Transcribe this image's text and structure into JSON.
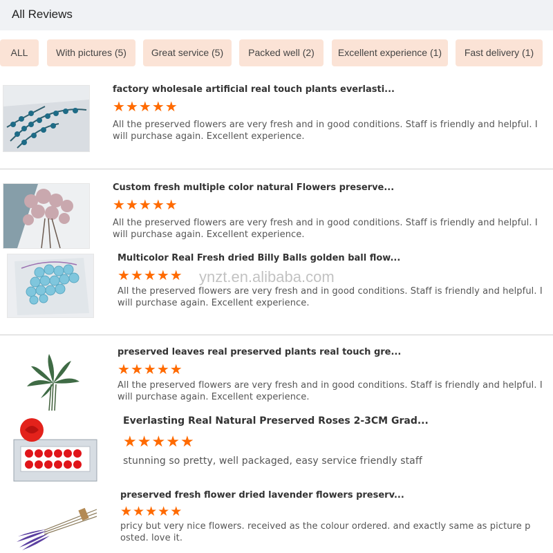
{
  "header": {
    "title": "All Reviews"
  },
  "filters": [
    {
      "label": "ALL"
    },
    {
      "label": "With pictures (5)"
    },
    {
      "label": "Great service (5)"
    },
    {
      "label": "Packed well (2)"
    },
    {
      "label": "Excellent experience (1)"
    },
    {
      "label": "Fast delivery (1)"
    }
  ],
  "reviews": [
    {
      "title": "factory wholesale artificial real touch plants everlasti...",
      "rating": 5,
      "text": "All the preserved flowers are very fresh and in good conditions. Staff is friendly and helpful. I will purchase again. Excellent experience."
    },
    {
      "title": "Custom fresh multiple color natural Flowers preserve...",
      "rating": 5,
      "text": "All the preserved flowers are very fresh and in good conditions. Staff is friendly and helpful. I will purchase again. Excellent experience."
    },
    {
      "title": "Multicolor Real Fresh dried Billy Balls golden ball flow...",
      "rating": 5,
      "text": "All the preserved flowers are very fresh and in good conditions. Staff is friendly and helpful. I will purchase again. Excellent experience."
    },
    {
      "title": "preserved leaves real preserved plants real touch gre...",
      "rating": 5,
      "text": "All the preserved flowers are very fresh and in good conditions. Staff is friendly and helpful. I will purchase again. Excellent experience."
    },
    {
      "title": "Everlasting Real Natural Preserved Roses 2-3CM Grad...",
      "rating": 5,
      "text": "stunning so pretty, well packaged, easy service friendly staff"
    },
    {
      "title": "preserved fresh flower dried lavender flowers preserv...",
      "rating": 5,
      "text": "pricy but very nice flowers. received as the colour ordered. and exactly same as picture posted. love it."
    }
  ],
  "watermark": "ynzt.en.alibaba.com",
  "colors": {
    "accent": "#ff6a00",
    "chip_bg": "#fbe3d6",
    "header_bg": "#f0f2f5"
  },
  "star_icon": "star-icon"
}
